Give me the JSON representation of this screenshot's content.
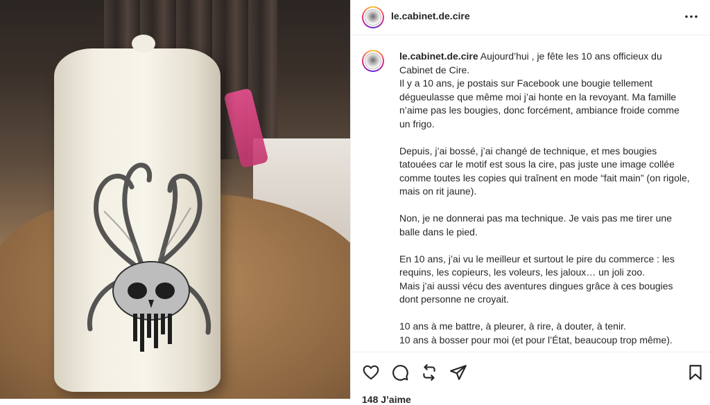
{
  "post": {
    "username": "le.cabinet.de.cire",
    "caption_intro": "Aujourd’hui , je fête les 10 ans officieux du Cabinet de Cire.",
    "caption_paragraphs": [
      "Il y a 10 ans, je postais sur Facebook une bougie tellement dégueulasse que même moi j’ai honte en la revoyant. Ma famille n’aime pas les bougies, donc forcément, ambiance froide comme un frigo.",
      "Depuis, j’ai bossé, j’ai changé de technique, et mes bougies tatouées car le motif est sous la cire, pas juste une image collée comme toutes les copies qui traînent en mode “fait main” (on rigole, mais on rit jaune).",
      "Non, je ne donnerai pas ma technique. Je vais pas me tirer une balle dans le pied.",
      "En 10 ans, j’ai vu le meilleur et surtout le pire du commerce : les requins, les copieurs, les voleurs, les jaloux… un joli zoo.\nMais j’ai aussi vécu des aventures dingues grâce à ces bougies dont personne ne croyait.",
      "10 ans à me battre, à pleurer, à rire, à douter, à tenir.\n10 ans à bosser pour moi (et pour l’État, beaucoup trop même)."
    ],
    "likes_text": "148 J’aime"
  },
  "icons": {
    "more": "more-horizontal-icon",
    "like": "heart-icon",
    "comment": "comment-icon",
    "repost": "repost-icon",
    "share": "send-icon",
    "save": "bookmark-icon"
  },
  "colors": {
    "text": "#262626",
    "border": "#efefef",
    "story_ring_start": "#f9ce34",
    "story_ring_mid": "#ee2a7b",
    "story_ring_end": "#6228d7"
  }
}
